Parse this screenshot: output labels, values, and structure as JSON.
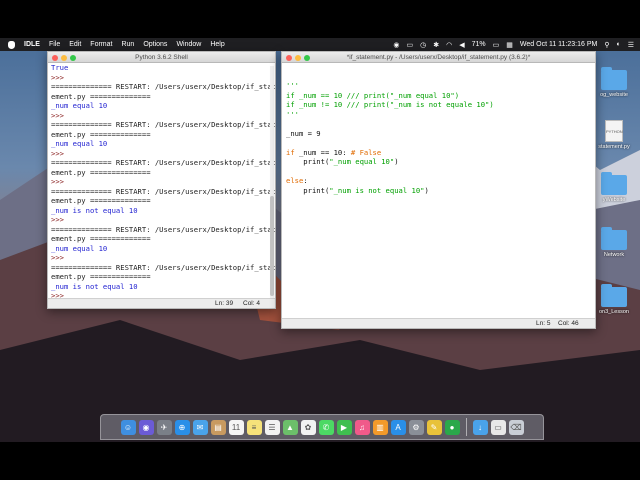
{
  "menubar": {
    "app": "IDLE",
    "items": [
      "File",
      "Edit",
      "Format",
      "Run",
      "Options",
      "Window",
      "Help"
    ],
    "battery": "71%",
    "datetime": "Wed Oct 11  11:23:16 PM"
  },
  "shell": {
    "title": "Python 3.6.2 Shell",
    "lines": [
      {
        "text": "True",
        "cls": "c-blue"
      },
      {
        "text": ">>> ",
        "cls": "c-prompt"
      },
      {
        "text": "============== RESTART: /Users/userx/Desktop/if_stat",
        "cls": "c-out"
      },
      {
        "text": "ement.py ==============",
        "cls": "c-out"
      },
      {
        "text": "_num equal 10",
        "cls": "c-blue"
      },
      {
        "text": ">>> ",
        "cls": "c-prompt"
      },
      {
        "text": "============== RESTART: /Users/userx/Desktop/if_stat",
        "cls": "c-out"
      },
      {
        "text": "ement.py ==============",
        "cls": "c-out"
      },
      {
        "text": "_num equal 10",
        "cls": "c-blue"
      },
      {
        "text": ">>> ",
        "cls": "c-prompt"
      },
      {
        "text": "============== RESTART: /Users/userx/Desktop/if_stat",
        "cls": "c-out"
      },
      {
        "text": "ement.py ==============",
        "cls": "c-out"
      },
      {
        "text": ">>> ",
        "cls": "c-prompt"
      },
      {
        "text": "============== RESTART: /Users/userx/Desktop/if_stat",
        "cls": "c-out"
      },
      {
        "text": "ement.py ==============",
        "cls": "c-out"
      },
      {
        "text": "_num is not equal 10",
        "cls": "c-blue"
      },
      {
        "text": ">>> ",
        "cls": "c-prompt"
      },
      {
        "text": "============== RESTART: /Users/userx/Desktop/if_stat",
        "cls": "c-out"
      },
      {
        "text": "ement.py ==============",
        "cls": "c-out"
      },
      {
        "text": "_num equal 10",
        "cls": "c-blue"
      },
      {
        "text": ">>> ",
        "cls": "c-prompt"
      },
      {
        "text": "============== RESTART: /Users/userx/Desktop/if_stat",
        "cls": "c-out"
      },
      {
        "text": "ement.py ==============",
        "cls": "c-out"
      },
      {
        "text": "_num is not equal 10",
        "cls": "c-blue"
      },
      {
        "text": ">>> ",
        "cls": "c-prompt"
      }
    ],
    "status_ln": "Ln: 39",
    "status_col": "Col: 4"
  },
  "editor": {
    "title": "*if_statement.py - /Users/userx/Desktop/if_statement.py (3.6.2)*",
    "lines": [
      [
        {
          "text": "'''",
          "cls": "e-green"
        }
      ],
      [
        {
          "text": "if _num == 10 /// print(\"_num equal 10\")",
          "cls": "e-green"
        }
      ],
      [
        {
          "text": "if _num != 10 /// print(\"_num is not equale 10\")",
          "cls": "e-green"
        }
      ],
      [
        {
          "text": "'''",
          "cls": "e-green"
        }
      ],
      [
        {
          "text": "",
          "cls": "e-black"
        }
      ],
      [
        {
          "text": "_num = 9",
          "cls": "e-black"
        }
      ],
      [
        {
          "text": "",
          "cls": "e-black"
        }
      ],
      [
        {
          "text": "if",
          "cls": "e-orange"
        },
        {
          "text": " _num == 10: ",
          "cls": "e-black"
        },
        {
          "text": "# False",
          "cls": "e-orange"
        }
      ],
      [
        {
          "text": "    print(",
          "cls": "e-black"
        },
        {
          "text": "\"_num equal 10\"",
          "cls": "e-green"
        },
        {
          "text": ")",
          "cls": "e-black"
        }
      ],
      [
        {
          "text": "",
          "cls": "e-black"
        }
      ],
      [
        {
          "text": "else",
          "cls": "e-orange"
        },
        {
          "text": ":",
          "cls": "e-black"
        }
      ],
      [
        {
          "text": "    print(",
          "cls": "e-black"
        },
        {
          "text": "\"_num is not equal 10\"",
          "cls": "e-green"
        },
        {
          "text": ")",
          "cls": "e-black"
        }
      ]
    ],
    "status_ln": "Ln: 5",
    "status_col": "Col: 46"
  },
  "desktop_icons": [
    {
      "label": "og_website",
      "kind": "folder"
    },
    {
      "label": "statement.py",
      "kind": "doc",
      "doc_text": "PYTHON"
    },
    {
      "label": "yWebsite",
      "kind": "folder"
    },
    {
      "label": "Network",
      "kind": "folder"
    },
    {
      "label": "on3_Lesson",
      "kind": "folder"
    }
  ],
  "dock": {
    "items": [
      {
        "name": "finder-icon",
        "color": "#3f8fe0",
        "glyph": "☺"
      },
      {
        "name": "siri-icon",
        "color": "#6b5bd6",
        "glyph": "◉"
      },
      {
        "name": "launchpad-icon",
        "color": "#7a7f88",
        "glyph": "✈"
      },
      {
        "name": "safari-icon",
        "color": "#2a8fe8",
        "glyph": "⊕"
      },
      {
        "name": "mail-icon",
        "color": "#4aa3ea",
        "glyph": "✉"
      },
      {
        "name": "contacts-icon",
        "color": "#c89a60",
        "glyph": "▤"
      },
      {
        "name": "calendar-icon",
        "color": "#f5f5f5",
        "glyph": "11"
      },
      {
        "name": "notes-icon",
        "color": "#f6e27a",
        "glyph": "≡"
      },
      {
        "name": "reminders-icon",
        "color": "#f2f2f2",
        "glyph": "☰"
      },
      {
        "name": "maps-icon",
        "color": "#6cbf6a",
        "glyph": "▲"
      },
      {
        "name": "photos-icon",
        "color": "#f2f2f2",
        "glyph": "✿"
      },
      {
        "name": "messages-icon",
        "color": "#4cd964",
        "glyph": "✆"
      },
      {
        "name": "facetime-icon",
        "color": "#3fbf4f",
        "glyph": "▶"
      },
      {
        "name": "itunes-icon",
        "color": "#f05a8a",
        "glyph": "♫"
      },
      {
        "name": "ibooks-icon",
        "color": "#f39a2a",
        "glyph": "▥"
      },
      {
        "name": "appstore-icon",
        "color": "#2a8fe8",
        "glyph": "A"
      },
      {
        "name": "system-preferences-icon",
        "color": "#8a8f98",
        "glyph": "⚙"
      },
      {
        "name": "idle-icon",
        "color": "#e8c23a",
        "glyph": "✎"
      },
      {
        "name": "chrome-icon",
        "color": "#2aa84a",
        "glyph": "●"
      },
      {
        "name": "downloads-icon",
        "color": "#4aa3ea",
        "glyph": "↓"
      },
      {
        "name": "documents-icon",
        "color": "#e8e8e8",
        "glyph": "▭"
      },
      {
        "name": "trash-icon",
        "color": "#c9ced6",
        "glyph": "⌫"
      }
    ]
  }
}
